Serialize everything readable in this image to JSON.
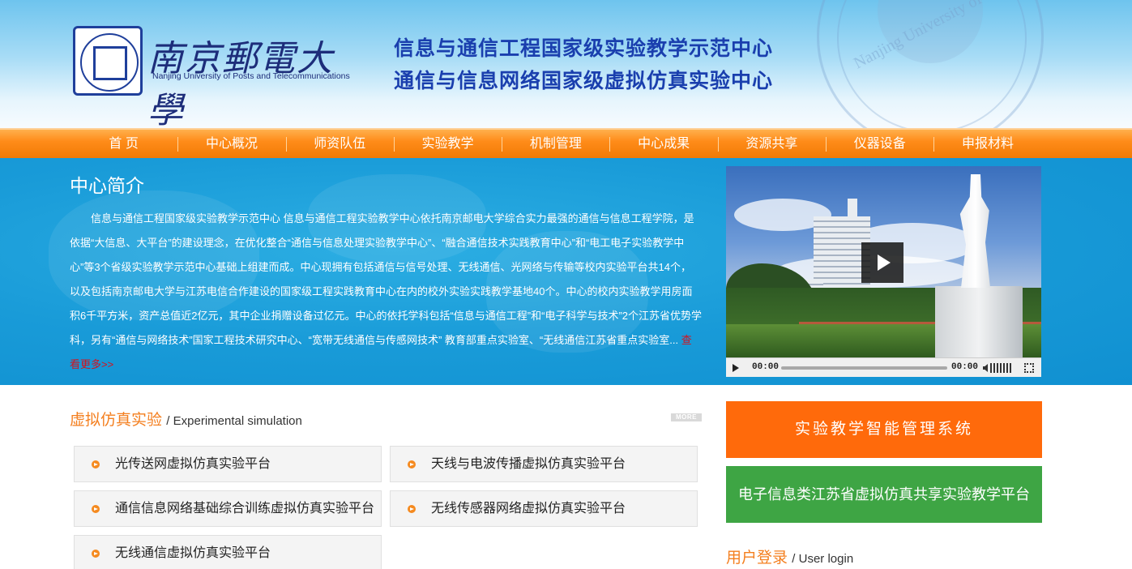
{
  "header": {
    "university_cn": "南京郵電大學",
    "university_en": "Nanjing University of Posts and Telecommunications",
    "seal_text": "Nanjing University of Posts and Telecommunications",
    "title_line1": "信息与通信工程国家级实验教学示范中心",
    "title_line2": "通信与信息网络国家级虚拟仿真实验中心"
  },
  "nav": {
    "items": [
      "首 页",
      "中心概况",
      "师资队伍",
      "实验教学",
      "机制管理",
      "中心成果",
      "资源共享",
      "仪器设备",
      "申报材料"
    ]
  },
  "intro": {
    "title": "中心简介",
    "text": "信息与通信工程国家级实验教学示范中心 信息与通信工程实验教学中心依托南京邮电大学综合实力最强的通信与信息工程学院，是依据“大信息、大平台”的建设理念，在优化整合“通信与信息处理实验教学中心”、“融合通信技术实践教育中心”和“电工电子实验教学中心”等3个省级实验教学示范中心基础上组建而成。中心现拥有包括通信与信号处理、无线通信、光网络与传输等校内实验平台共14个，以及包括南京邮电大学与江苏电信合作建设的国家级工程实践教育中心在内的校外实验实践教学基地40个。中心的校内实验教学用房面积6千平方米，资产总值近2亿元，其中企业捐赠设备过亿元。中心的依托学科包括“信息与通信工程”和“电子科学与技术”2个江苏省优势学科，另有“通信与网络技术”国家工程技术研究中心、“宽带无线通信与传感网技术” 教育部重点实验室、“无线通信江苏省重点实验室...",
    "more_label": "查看更多>>"
  },
  "video": {
    "current_time": "00:00",
    "duration": "00:00",
    "progress": 0
  },
  "simulation": {
    "title": "虚拟仿真实验",
    "title_en": "/ Experimental simulation",
    "more_badge": "MORE",
    "items": [
      "光传送网虚拟仿真实验平台",
      "天线与电波传播虚拟仿真实验平台",
      "通信信息网络基础综合训练虚拟仿真实验平台",
      "无线传感器网络虚拟仿真实验平台",
      "无线通信虚拟仿真实验平台"
    ]
  },
  "sidebar": {
    "btn1": "实验教学智能管理系统",
    "btn2": "电子信息类江苏省虚拟仿真共享实验教学平台",
    "login_title": "用户登录",
    "login_title_en": "/ User login"
  },
  "colors": {
    "nav_orange": "#f17a05",
    "intro_blue": "#199bd8",
    "accent_orange": "#f47f1f",
    "btn_orange": "#ff6a0b",
    "btn_green": "#3ea544",
    "title_blue": "#1a3fae",
    "more_red": "#d6111c"
  }
}
